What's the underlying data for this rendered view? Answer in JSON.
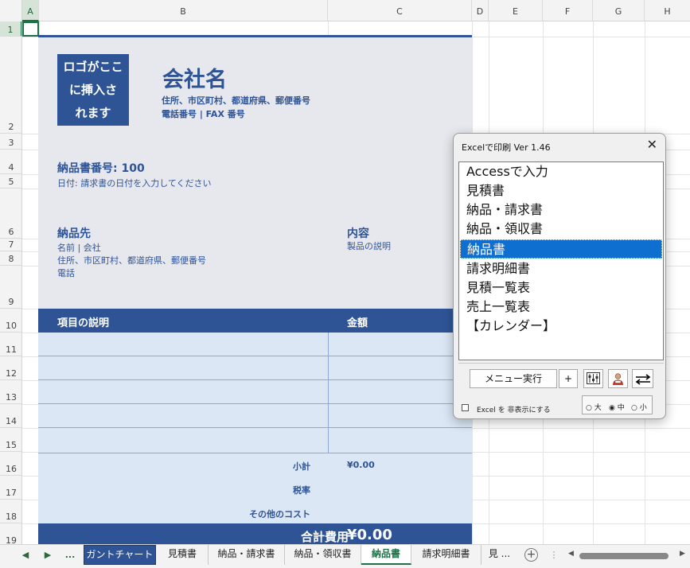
{
  "columns": [
    "A",
    "B",
    "C",
    "D",
    "E",
    "F",
    "G",
    "H"
  ],
  "rows": [
    "1",
    "2",
    "3",
    "4",
    "5",
    "6",
    "7",
    "8",
    "9",
    "10",
    "11",
    "12",
    "13",
    "14",
    "15",
    "16",
    "17",
    "18",
    "19"
  ],
  "invoice": {
    "logo_line1": "ロゴがここ",
    "logo_line2": "に挿入さ",
    "logo_line3": "れます",
    "company_name": "会社名",
    "address": "住所、市区町村、都道府県、郵便番号",
    "phone_fax": "電話番号 | FAX 番号",
    "delivery_no": "納品書番号: 100",
    "date_hint": "日付: 請求書の日付を入力してください",
    "destination_title": "納品先",
    "destination_name": "名前 | 会社",
    "destination_address": "住所、市区町村、都道府県、郵便番号",
    "destination_phone": "電話",
    "content_title": "内容",
    "content_desc": "製品の説明",
    "col_item": "項目の説明",
    "col_amount": "金額",
    "subtotal_label": "小計",
    "subtotal_value": "¥0.00",
    "tax_label": "税率",
    "other_label": "その他のコスト",
    "total_label": "合計費用",
    "total_value": "¥0.00"
  },
  "dialog": {
    "title": "Excelで印刷 Ver 1.46",
    "close_glyph": "✕",
    "items": [
      "Accessで入力",
      "見積書",
      "納品・請求書",
      "納品・領収書",
      "納品書",
      "請求明細書",
      "見積一覧表",
      "売上一覧表",
      "【カレンダー】"
    ],
    "selected_index": 4,
    "run_button": "メニュー実行",
    "plus_button": "+",
    "hide_excel_label": "Excel を 非表示にする",
    "size_large": "大",
    "size_medium": "中",
    "size_small": "小"
  },
  "tabs": {
    "ellipsis": "...",
    "gantt": "ガントチャート",
    "quote": "見積書",
    "invoice_bill": "納品・請求書",
    "invoice_receipt": "納品・領収書",
    "delivery": "納品書",
    "statement": "請求明細書",
    "more": "見 ...",
    "add": "+"
  },
  "colors": {
    "accent": "#2f5496",
    "excel_green": "#1e7145",
    "selection_blue": "#0f6fd1",
    "table_fill": "#dbe7f5"
  }
}
